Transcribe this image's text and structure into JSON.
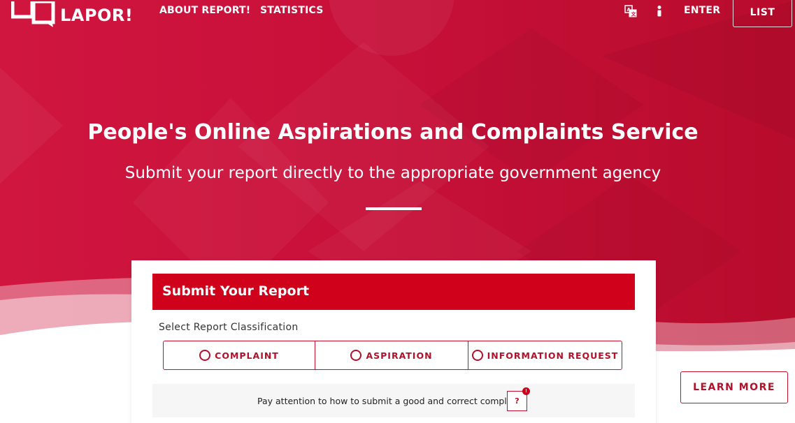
{
  "brand": {
    "name": "LAPOR!",
    "logo_icon": "speech-bubbles-logo-icon"
  },
  "nav": {
    "about": "ABOUT REPORT!",
    "statistics": "STATISTICS",
    "language_icon": "translate-icon",
    "info_icon": "info-icon",
    "enter": "ENTER",
    "list": "LIST"
  },
  "hero": {
    "title": "People's Online Aspirations and Complaints Service",
    "subtitle": "Submit your report directly to the appropriate government agency"
  },
  "report_form": {
    "header": "Submit Your Report",
    "classification_label": "Select Report Classification",
    "options": [
      {
        "label": "COMPLAINT",
        "selected": false
      },
      {
        "label": "ASPIRATION",
        "selected": false
      },
      {
        "label": "INFORMATION REQUEST",
        "selected": false
      }
    ],
    "tip_text": "Pay attention to how to submit a good and correct complaint",
    "help_button": "?",
    "help_badge": "!"
  },
  "learn_more": "LEARN MORE",
  "colors": {
    "primary_red": "#d0021b",
    "hero_red": "#c8103a",
    "accent_text_red": "#b3102a"
  }
}
